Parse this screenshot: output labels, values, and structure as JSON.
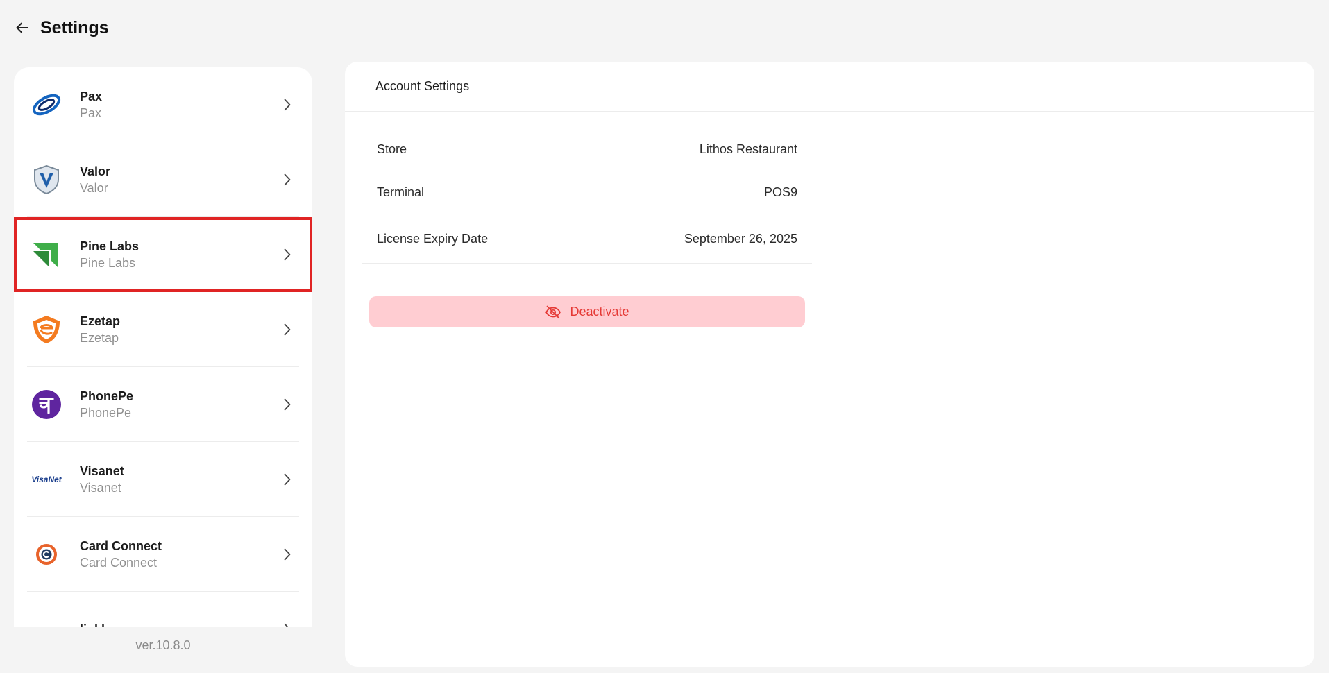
{
  "header": {
    "title": "Settings"
  },
  "sidebar": {
    "items": [
      {
        "title": "Pax",
        "subtitle": "Pax",
        "icon": "pax-logo-icon"
      },
      {
        "title": "Valor",
        "subtitle": "Valor",
        "icon": "valor-logo-icon"
      },
      {
        "title": "Pine Labs",
        "subtitle": "Pine Labs",
        "icon": "pine-labs-logo-icon",
        "selected": true
      },
      {
        "title": "Ezetap",
        "subtitle": "Ezetap",
        "icon": "ezetap-logo-icon"
      },
      {
        "title": "PhonePe",
        "subtitle": "PhonePe",
        "icon": "phonepe-logo-icon"
      },
      {
        "title": "Visanet",
        "subtitle": "Visanet",
        "icon": "visanet-logo-icon",
        "logo_text": "VisaNet"
      },
      {
        "title": "Card Connect",
        "subtitle": "Card Connect",
        "icon": "card-connect-logo-icon"
      },
      {
        "title": "linkly",
        "subtitle": "",
        "icon": "linkly-logo-icon"
      }
    ]
  },
  "version": "ver.10.8.0",
  "main": {
    "title": "Account Settings",
    "rows": [
      {
        "label": "Store",
        "value": "Lithos Restaurant"
      },
      {
        "label": "Terminal",
        "value": "POS9"
      },
      {
        "label": "License Expiry Date",
        "value": "September 26, 2025"
      }
    ],
    "deactivate_label": "Deactivate"
  },
  "colors": {
    "selection_outline": "#e02424",
    "deactivate_bg": "#ffcdd2",
    "deactivate_text": "#e53935"
  }
}
